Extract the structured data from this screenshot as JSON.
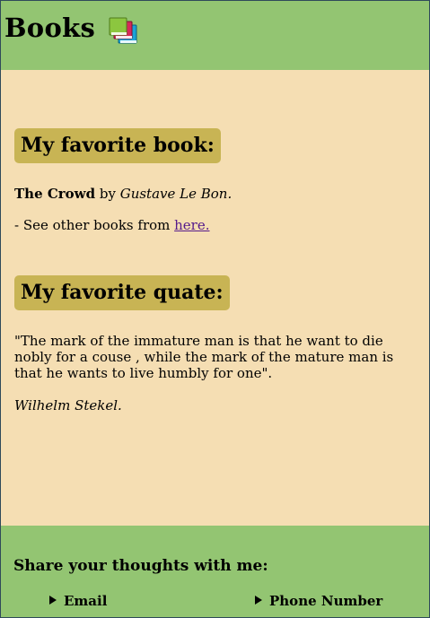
{
  "header": {
    "title": "Books",
    "icon": "books-icon"
  },
  "favorite_book": {
    "heading": "My favorite book:",
    "title": "The Crowd",
    "by_text": " by ",
    "author": "Gustave Le Bon.",
    "see_prefix": "- See other books from ",
    "link_label": "here."
  },
  "favorite_quote": {
    "heading": "My favorite quate:",
    "text": "\"The mark of the immature man is that he want to die nobly for a couse , while the mark of the mature man is that he wants to live humbly for one\".",
    "author": "Wilhelm Stekel."
  },
  "footer": {
    "title": "Share your thoughts with me:",
    "contacts": [
      {
        "label": "Email",
        "icon": "disclosure-triangle-icon"
      },
      {
        "label": "Phone Number",
        "icon": "disclosure-triangle-icon"
      }
    ]
  },
  "colors": {
    "header_bg": "#93c572",
    "page_bg": "#f5deb3",
    "heading_bg": "#c8b454",
    "link": "#551a8b"
  }
}
